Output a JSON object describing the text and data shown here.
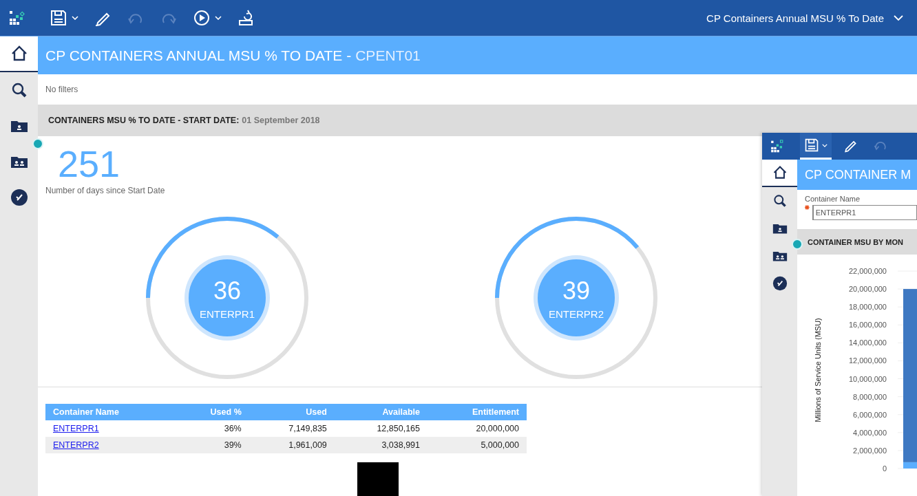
{
  "toolbar": {
    "items": [
      {
        "disabled": false,
        "has_menu": true
      },
      {
        "disabled": false,
        "has_menu": false
      },
      {
        "disabled": true,
        "has_menu": false
      },
      {
        "disabled": true,
        "has_menu": false
      },
      {
        "disabled": false,
        "has_menu": true
      },
      {
        "disabled": false,
        "has_menu": false
      }
    ],
    "report_menu": "CP Containers Annual MSU % To Date"
  },
  "sidebar": {
    "items": [
      {
        "selected": true
      },
      {
        "selected": false
      },
      {
        "selected": false
      },
      {
        "selected": false
      },
      {
        "selected": false
      }
    ]
  },
  "header": {
    "title": "CP CONTAINERS ANNUAL MSU % TO DATE -",
    "context": "CPENT01"
  },
  "filters": "No filters",
  "section": {
    "label": "CONTAINERS MSU % TO DATE - START DATE:",
    "value": "01 September 2018"
  },
  "kpi": {
    "value": "251",
    "caption": "Number of days since Start Date"
  },
  "gauges": [
    {
      "value": "36",
      "name": "ENTERPR1"
    },
    {
      "value": "39",
      "name": "ENTERPR2"
    }
  ],
  "table": {
    "columns": [
      "Container Name",
      "Used %",
      "Used",
      "Available",
      "Entitlement"
    ],
    "rows": [
      [
        "ENTERPR1",
        "36%",
        "7,149,835",
        "12,850,165",
        "20,000,000"
      ],
      [
        "ENTERPR2",
        "39%",
        "1,961,009",
        "3,038,991",
        "5,000,000"
      ]
    ]
  },
  "popup": {
    "toolbar": [
      {
        "selected": true
      },
      {
        "selected": false
      },
      {
        "selected": false
      }
    ],
    "sidebar": {
      "items": [
        {
          "selected": true
        },
        {
          "selected": false
        },
        {
          "selected": false
        },
        {
          "selected": false
        },
        {
          "selected": false
        }
      ]
    },
    "header": "CP CONTAINER M",
    "filter": {
      "label": "Container Name",
      "required": true,
      "value": "ENTERPR1"
    },
    "section": "CONTAINER MSU BY MON",
    "chart_data": {
      "type": "bar",
      "ylabel": "Millions of Service Units (MSU)",
      "stacked": true,
      "grid": true,
      "ylim": [
        0,
        22000000
      ],
      "yticks": [
        {
          "value": 0,
          "label": "0"
        },
        {
          "value": 2000000,
          "label": "2,000,000"
        },
        {
          "value": 4000000,
          "label": "4,000,000"
        },
        {
          "value": 6000000,
          "label": "6,000,000"
        },
        {
          "value": 8000000,
          "label": "8,000,000"
        },
        {
          "value": 10000000,
          "label": "10,000,000"
        },
        {
          "value": 12000000,
          "label": "12,000,000"
        },
        {
          "value": 14000000,
          "label": "14,000,000"
        },
        {
          "value": 16000000,
          "label": "16,000,000"
        },
        {
          "value": 18000000,
          "label": "18,000,000"
        },
        {
          "value": 20000000,
          "label": "20,000,000"
        },
        {
          "value": 22000000,
          "label": "22,000,000"
        }
      ],
      "series": [
        {
          "color": "#5aaefe",
          "values": [
            700000
          ]
        },
        {
          "color": "#3e78c2",
          "values": [
            19300000
          ]
        }
      ]
    }
  }
}
